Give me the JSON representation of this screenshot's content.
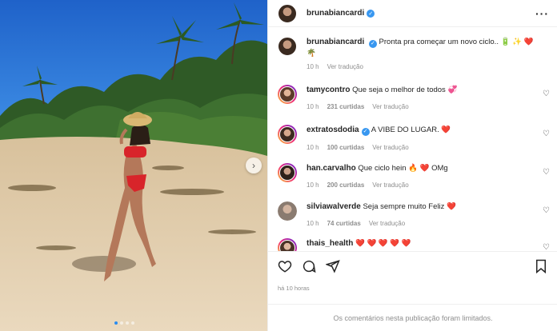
{
  "post": {
    "author": "brunabiancardi",
    "more_icon": "more-horizontal-icon",
    "caption_author": "brunabiancardi",
    "caption_text": "Pronta pra começar um novo ciclo..",
    "caption_emoji": "🔋 ✨ ❤️",
    "caption_emoji_2": "🌴",
    "caption_time": "10 h",
    "caption_translate": "Ver tradução"
  },
  "comments": [
    {
      "user": "tamycontro",
      "verified": false,
      "text": "Que seja o melhor de todos 💞",
      "time": "10 h",
      "likes": "231 curtidas",
      "translate": "Ver tradução"
    },
    {
      "user": "extratosdodia",
      "verified": true,
      "text": "A VIBE DO LUGAR. ❤️",
      "time": "10 h",
      "likes": "100 curtidas",
      "translate": "Ver tradução"
    },
    {
      "user": "han.carvalho",
      "verified": false,
      "text": "Que ciclo hein 🔥 ❤️ OMg",
      "time": "10 h",
      "likes": "200 curtidas",
      "translate": "Ver tradução"
    },
    {
      "user": "silviawalverde",
      "verified": false,
      "text": "Seja sempre muito Feliz ❤️",
      "time": "10 h",
      "likes": "74 curtidas",
      "translate": "Ver tradução"
    },
    {
      "user": "thais_health",
      "verified": false,
      "text": "❤️ ❤️ ❤️ ❤️ ❤️",
      "time": "",
      "likes": "",
      "translate": ""
    }
  ],
  "footer": {
    "posted": "há 10 horas",
    "limited": "Os comentários nesta publicação foram limitados."
  },
  "colors": {
    "accent": "#3897f0",
    "heart": "#ed4956",
    "muted": "#8e8e8e"
  }
}
